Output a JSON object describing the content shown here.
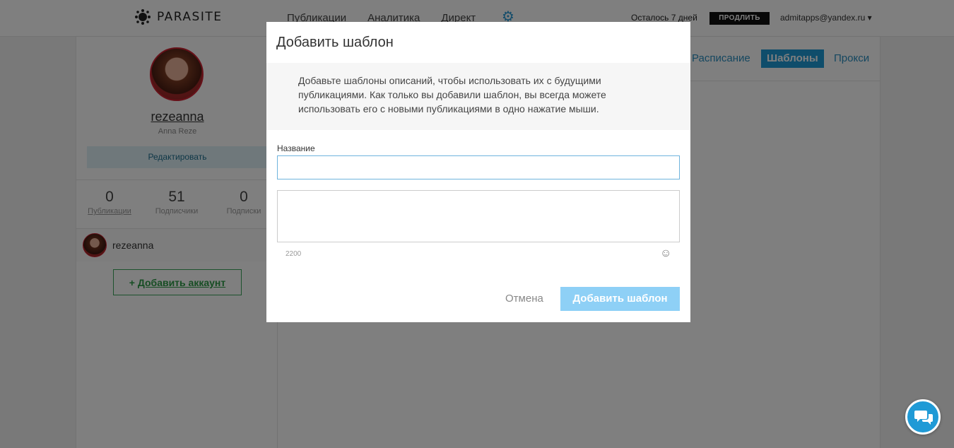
{
  "header": {
    "logo_text": "PARASITE",
    "nav": [
      "Публикации",
      "Аналитика",
      "Директ"
    ],
    "settings_icon": "gear-icon",
    "remaining": "Осталось 7 дней",
    "extend_label": "ПРОДЛИТЬ",
    "account": "admitapps@yandex.ru ▾"
  },
  "profile": {
    "username": "rezeanna",
    "full_name": "Anna Reze",
    "edit_label": "Редактировать",
    "stats": [
      {
        "value": "0",
        "label": "Публикации"
      },
      {
        "value": "51",
        "label": "Подписчики"
      },
      {
        "value": "0",
        "label": "Подписки"
      }
    ],
    "account_item": "rezeanna",
    "add_account_plus": "+",
    "add_account_label": "Добавить аккаунт"
  },
  "main": {
    "tabs": [
      {
        "label": "Расписание",
        "active": false
      },
      {
        "label": "Шаблоны",
        "active": true
      },
      {
        "label": "Прокси",
        "active": false
      }
    ]
  },
  "modal": {
    "title": "Добавить шаблон",
    "description": "Добавьте шаблоны описаний, чтобы использовать их с будущими публикациями. Как только вы добавили шаблон, вы всегда можете использовать его с новыми публикациями в одно нажатие мыши.",
    "name_label": "Название",
    "name_value": "",
    "body_value": "",
    "char_counter": "2200",
    "emoji_icon": "smiley-icon",
    "cancel_label": "Отмена",
    "submit_label": "Добавить шаблон"
  },
  "colors": {
    "accent": "#1f9ad6",
    "submit_disabled": "#8ed0f6",
    "add_account_green": "#2d9a47"
  }
}
